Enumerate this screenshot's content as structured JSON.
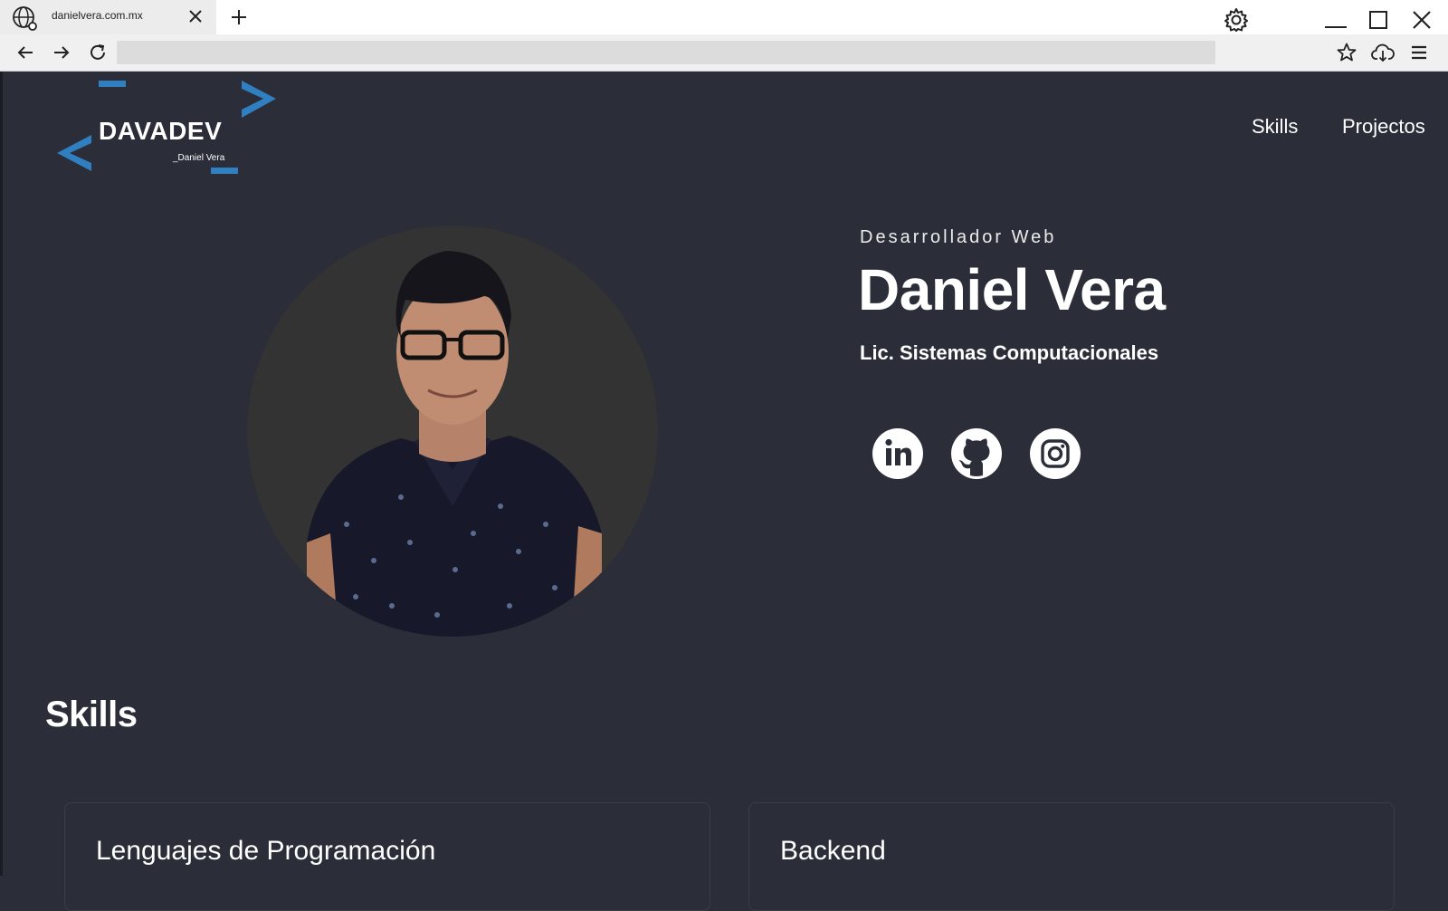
{
  "browser": {
    "tab_title": "danielvera.com.mx",
    "url": ""
  },
  "site": {
    "logo_text": "DAVADEV",
    "logo_sub": "_Daniel Vera",
    "menu": [
      "Skills",
      "Projectos"
    ],
    "accent": "#2f7fc1"
  },
  "hero": {
    "role": "Desarrollador Web",
    "name": "Daniel Vera",
    "degree": "Lic. Sistemas Computacionales",
    "social": [
      "linkedin-icon",
      "github-icon",
      "instagram-icon"
    ]
  },
  "skills": {
    "title": "Skills",
    "cards": [
      "Lenguajes de Programación",
      "Backend"
    ]
  }
}
